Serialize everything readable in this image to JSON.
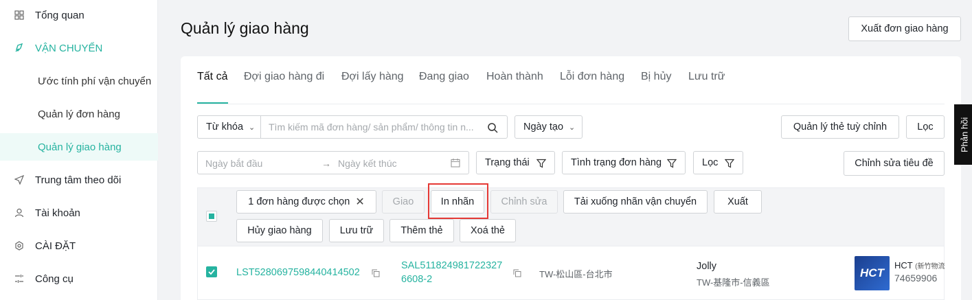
{
  "sidebar": {
    "items": [
      {
        "label": "Tổng quan",
        "icon": "grid-icon"
      },
      {
        "label": "VẬN CHUYỂN",
        "icon": "rocket-icon"
      },
      {
        "label": "Ước tính phí vận chuyển"
      },
      {
        "label": "Quản lý đơn hàng"
      },
      {
        "label": "Quản lý giao hàng",
        "active": true
      },
      {
        "label": "Trung tâm theo dõi",
        "icon": "send-icon"
      },
      {
        "label": "Tài khoản",
        "icon": "user-icon"
      },
      {
        "label": "CÀI ĐẶT",
        "icon": "gear-icon"
      },
      {
        "label": "Công cụ",
        "icon": "tools-icon"
      }
    ]
  },
  "header": {
    "title": "Quản lý giao hàng",
    "export_button": "Xuất đơn giao hàng"
  },
  "tabs": [
    "Tất cả",
    "Đợi giao hàng đi",
    "Đợi lấy hàng",
    "Đang giao",
    "Hoàn thành",
    "Lỗi đơn hàng",
    "Bị hủy",
    "Lưu trữ"
  ],
  "filters": {
    "keyword_select": "Từ khóa",
    "search_placeholder": "Tìm kiếm mã đơn hàng/ sản phẩm/ thông tin n...",
    "date_select": "Ngày tạo",
    "manage_tags": "Quản lý thẻ tuỳ chỉnh",
    "filter": "Lọc",
    "start_date": "Ngày bắt đầu",
    "end_date": "Ngày kết thúc",
    "status": "Trạng thái",
    "order_state": "Tình trạng đơn hàng",
    "filter2": "Lọc",
    "edit_header": "Chỉnh sửa tiêu đề"
  },
  "bulk": {
    "selected": "1 đơn hàng được chọn",
    "deliver": "Giao",
    "print_label": "In nhãn",
    "edit": "Chỉnh sửa",
    "download_label": "Tải xuống nhãn vận chuyển",
    "export": "Xuất",
    "cancel": "Hủy giao hàng",
    "archive": "Lưu trữ",
    "add_tag": "Thêm thẻ",
    "remove_tag": "Xoá thẻ"
  },
  "row": {
    "order_id": "LST5280697598440414502",
    "ref_line1": "SAL511824981722327",
    "ref_line2": "6608-2",
    "origin": "TW-松山區-台北市",
    "recipient_name": "Jolly",
    "recipient_addr": "TW-基隆市-信義區",
    "carrier_logo": "HCT",
    "carrier_name": "HCT",
    "carrier_sub": "(新竹物流",
    "tracking": "74659906"
  },
  "feedback": "Phản hồi",
  "colors": {
    "accent": "#26b3a0",
    "highlight": "#e53935"
  }
}
